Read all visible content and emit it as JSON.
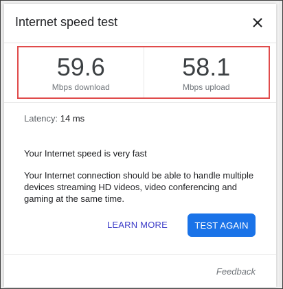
{
  "dialog": {
    "title": "Internet speed test",
    "close_icon": "close-icon"
  },
  "results": {
    "download_value": "59.6",
    "download_unit": "Mbps download",
    "upload_value": "58.1",
    "upload_unit": "Mbps upload",
    "highlight_color": "#e04b4b"
  },
  "latency": {
    "label": "Latency:",
    "value": "14 ms"
  },
  "message": {
    "headline": "Your Internet speed is very fast",
    "description": "Your Internet connection should be able to handle multiple devices streaming HD videos, video conferencing and gaming at the same time."
  },
  "actions": {
    "learn_more": "LEARN MORE",
    "test_again": "TEST AGAIN",
    "primary_color": "#1a73e8"
  },
  "footer": {
    "feedback": "Feedback"
  }
}
